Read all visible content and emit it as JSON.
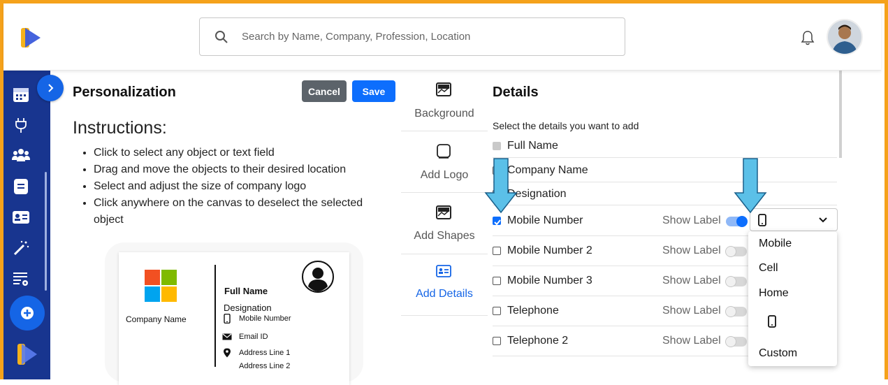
{
  "header": {
    "search_placeholder": "Search by Name, Company, Profession, Location"
  },
  "personalization": {
    "title": "Personalization",
    "cancel_label": "Cancel",
    "save_label": "Save",
    "instructions_title": "Instructions:",
    "instructions": [
      "Click to select any object or text field",
      "Drag and move the objects to their desired location",
      "Select and adjust the size of company logo",
      "Click anywhere on the canvas to deselect the selected object"
    ]
  },
  "card": {
    "company_name": "Company Name",
    "full_name": "Full Name",
    "designation": "Designation",
    "mobile": "Mobile Number",
    "email": "Email ID",
    "address1": "Address Line 1",
    "address2": "Address Line 2"
  },
  "tabs": [
    {
      "label": "Background",
      "icon": "image-icon"
    },
    {
      "label": "Add Logo",
      "icon": "square-icon"
    },
    {
      "label": "Add Shapes",
      "icon": "image-icon"
    },
    {
      "label": "Add Details",
      "icon": "id-card-icon",
      "active": true
    }
  ],
  "details": {
    "title": "Details",
    "subtitle": "Select the details you want to add",
    "show_label": "Show Label",
    "rows": [
      {
        "label": "Full Name",
        "checked": true,
        "disabled": true
      },
      {
        "label": "Company Name",
        "checked": false
      },
      {
        "label": "Designation",
        "checked": false
      },
      {
        "label": "Mobile Number",
        "checked": true,
        "show_label": true
      },
      {
        "label": "Mobile Number 2",
        "checked": false,
        "show_label": false
      },
      {
        "label": "Mobile Number 3",
        "checked": false,
        "show_label": false
      },
      {
        "label": "Telephone",
        "checked": false,
        "show_label": false
      },
      {
        "label": "Telephone 2",
        "checked": false,
        "show_label": false
      }
    ]
  },
  "dropdown": {
    "selected_icon": "phone-icon",
    "options": [
      "Mobile",
      "Cell",
      "Home",
      "phone-icon",
      "Custom"
    ]
  },
  "colors": {
    "border": "#f5a21b",
    "sidebar": "#18358f",
    "primary": "#0d6efd",
    "arrow": "#5bc0e8"
  }
}
